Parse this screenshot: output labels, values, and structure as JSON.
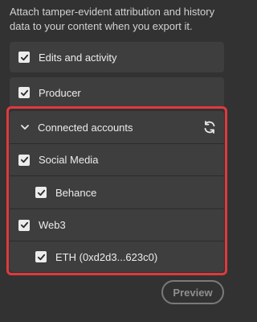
{
  "description": "Attach tamper-evident attribution and history data to your content when you export it.",
  "options": {
    "edits_activity": {
      "label": "Edits and activity",
      "checked": true
    },
    "producer": {
      "label": "Producer",
      "checked": true
    }
  },
  "connected_accounts": {
    "header_label": "Connected accounts",
    "expanded": true,
    "items": [
      {
        "label": "Social Media",
        "checked": true,
        "level": 0
      },
      {
        "label": "Behance",
        "checked": true,
        "level": 1
      },
      {
        "label": "Web3",
        "checked": true,
        "level": 0
      },
      {
        "label": "ETH (0xd2d3...623c0)",
        "checked": true,
        "level": 1
      }
    ]
  },
  "preview_label": "Preview",
  "colors": {
    "background": "#323232",
    "card": "#3e3e3e",
    "highlight_border": "#e0393e"
  }
}
